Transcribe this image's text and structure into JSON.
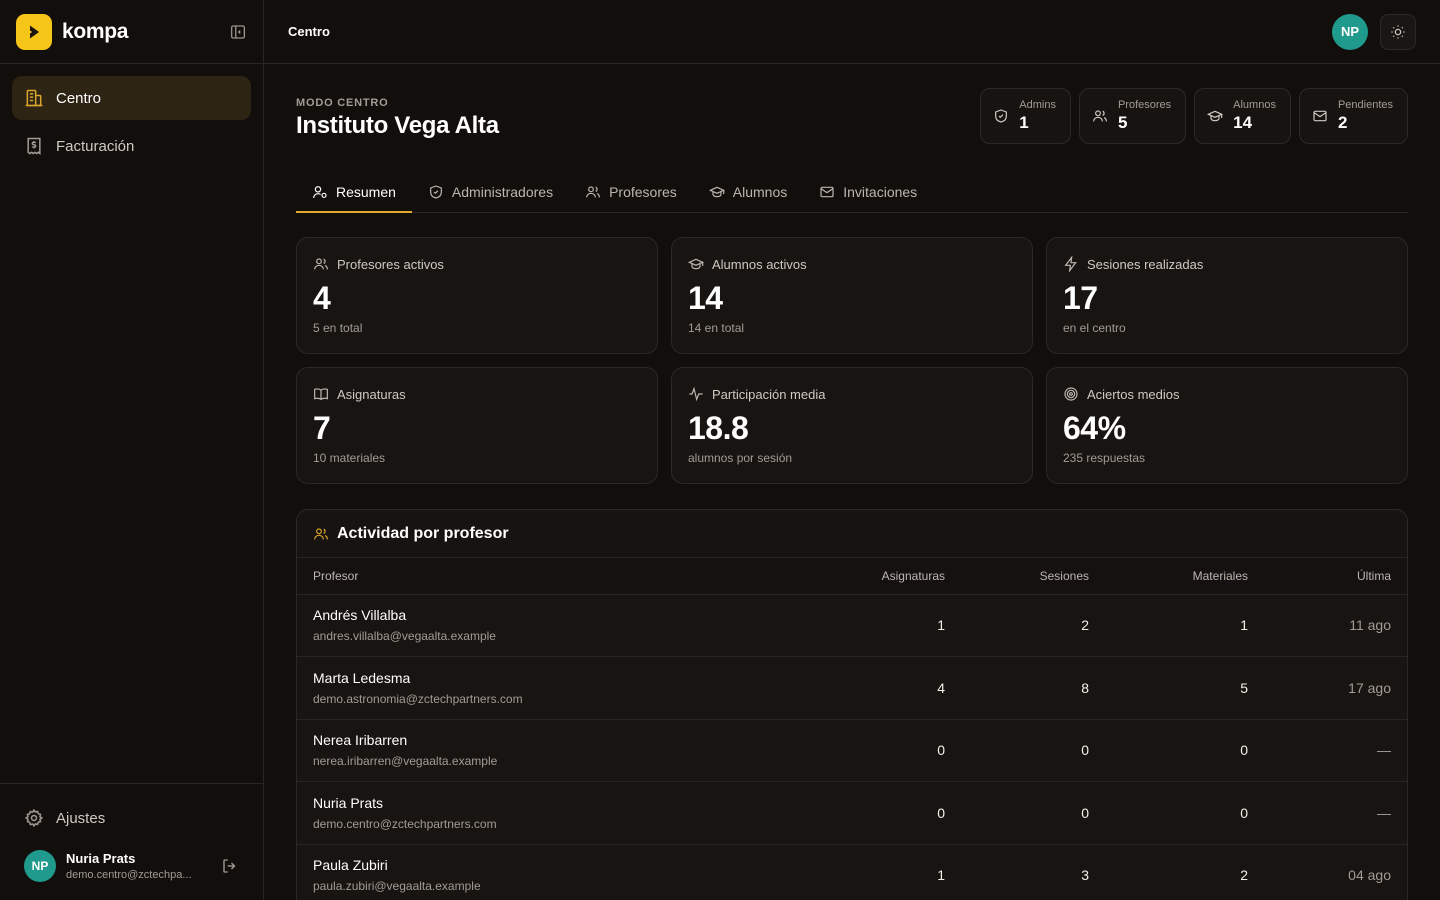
{
  "brand": {
    "name": "kompa"
  },
  "sidebar": {
    "items": [
      {
        "label": "Centro",
        "active": true
      },
      {
        "label": "Facturación",
        "active": false
      }
    ],
    "settings_label": "Ajustes",
    "user": {
      "initials": "NP",
      "name": "Nuria Prats",
      "email": "demo.centro@zctechpa..."
    }
  },
  "topbar": {
    "title": "Centro",
    "avatar_initials": "NP"
  },
  "header": {
    "mode": "MODO CENTRO",
    "title": "Instituto Vega Alta",
    "stats": [
      {
        "label": "Admins",
        "value": "1",
        "icon": "shield-icon"
      },
      {
        "label": "Profesores",
        "value": "5",
        "icon": "users-icon"
      },
      {
        "label": "Alumnos",
        "value": "14",
        "icon": "graduation-cap-icon"
      },
      {
        "label": "Pendientes",
        "value": "2",
        "icon": "mail-icon"
      }
    ]
  },
  "tabs": [
    {
      "label": "Resumen",
      "active": true
    },
    {
      "label": "Administradores",
      "active": false
    },
    {
      "label": "Profesores",
      "active": false
    },
    {
      "label": "Alumnos",
      "active": false
    },
    {
      "label": "Invitaciones",
      "active": false
    }
  ],
  "cards": [
    {
      "title": "Profesores activos",
      "value": "4",
      "sub": "5 en total",
      "icon": "users-icon"
    },
    {
      "title": "Alumnos activos",
      "value": "14",
      "sub": "14 en total",
      "icon": "graduation-cap-icon"
    },
    {
      "title": "Sesiones realizadas",
      "value": "17",
      "sub": "en el centro",
      "icon": "bolt-icon"
    },
    {
      "title": "Asignaturas",
      "value": "7",
      "sub": "10 materiales",
      "icon": "book-icon"
    },
    {
      "title": "Participación media",
      "value": "18.8",
      "sub": "alumnos por sesión",
      "icon": "activity-icon"
    },
    {
      "title": "Aciertos medios",
      "value": "64%",
      "sub": "235 respuestas",
      "icon": "target-icon"
    }
  ],
  "activity": {
    "title": "Actividad por profesor",
    "columns": [
      "Profesor",
      "Asignaturas",
      "Sesiones",
      "Materiales",
      "Última"
    ],
    "rows": [
      {
        "name": "Andrés Villalba",
        "email": "andres.villalba@vegaalta.example",
        "subjects": "1",
        "sessions": "2",
        "materials": "1",
        "last": "11 ago"
      },
      {
        "name": "Marta Ledesma",
        "email": "demo.astronomia@zctechpartners.com",
        "subjects": "4",
        "sessions": "8",
        "materials": "5",
        "last": "17 ago"
      },
      {
        "name": "Nerea Iribarren",
        "email": "nerea.iribarren@vegaalta.example",
        "subjects": "0",
        "sessions": "0",
        "materials": "0",
        "last": "—"
      },
      {
        "name": "Nuria Prats",
        "email": "demo.centro@zctechpartners.com",
        "subjects": "0",
        "sessions": "0",
        "materials": "0",
        "last": "—"
      },
      {
        "name": "Paula Zubiri",
        "email": "paula.zubiri@vegaalta.example",
        "subjects": "1",
        "sessions": "3",
        "materials": "2",
        "last": "04 ago"
      }
    ]
  }
}
